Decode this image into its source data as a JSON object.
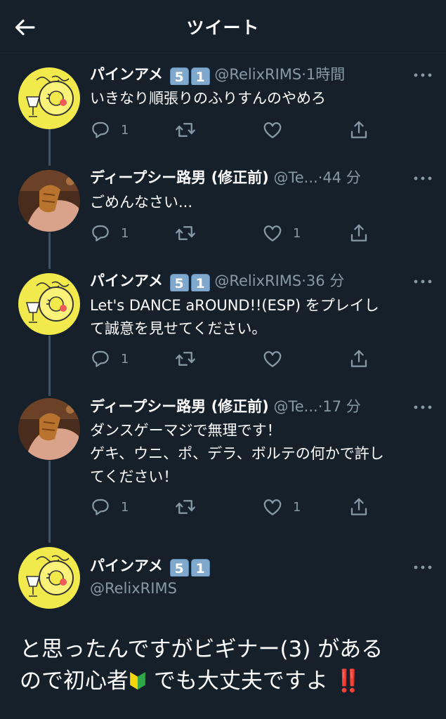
{
  "header": {
    "title": "ツイート"
  },
  "tweets": [
    {
      "name": "パインアメ",
      "badges": [
        "5",
        "1"
      ],
      "handle": "@RelixRIMS",
      "dot": "·",
      "time": "1時間",
      "text": "いきなり順張りのふりすんのやめろ",
      "replies": "1",
      "likes": ""
    },
    {
      "name": "ディープシー路男 (修正前)",
      "handle": "@Te...",
      "dot": "·",
      "time": "44 分",
      "text": "ごめんなさい...",
      "replies": "1",
      "likes": "1"
    },
    {
      "name": "パインアメ",
      "badges": [
        "5",
        "1"
      ],
      "handle": "@RelixRIMS",
      "dot": "·",
      "time": "36 分",
      "text_lines": [
        "Let's DANCE aROUND!!(ESP) をプレイし",
        "て誠意を見せてください。"
      ],
      "replies": "1",
      "likes": ""
    },
    {
      "name": "ディープシー路男 (修正前)",
      "handle": "@Te...",
      "dot": "·",
      "time": "17 分",
      "text_lines": [
        "ダンスゲーマジで無理です！",
        "ゲキ、ウニ、ポ、デラ、ボルテの何かで許し",
        "てください！"
      ],
      "replies": "1",
      "likes": "1"
    }
  ],
  "main": {
    "name": "パインアメ",
    "badges": [
      "5",
      "1"
    ],
    "handle": "@RelixRIMS",
    "text_line1": "と思ったんですがビギナー(3) がある",
    "text_line2_pre": "ので初心者",
    "text_line2_mid": " でも大丈夫ですよ ",
    "text_line2_end": "‼️"
  },
  "colors": {
    "background": "#15202b",
    "secondary_text": "#8899a6",
    "thread_line": "#3d5466",
    "badge": "#7fa8cc",
    "alert": "#e8222b"
  },
  "icons": [
    "back-arrow-icon",
    "more-icon",
    "reply-icon",
    "retweet-icon",
    "like-icon",
    "share-icon",
    "beginner-leaf-icon"
  ]
}
